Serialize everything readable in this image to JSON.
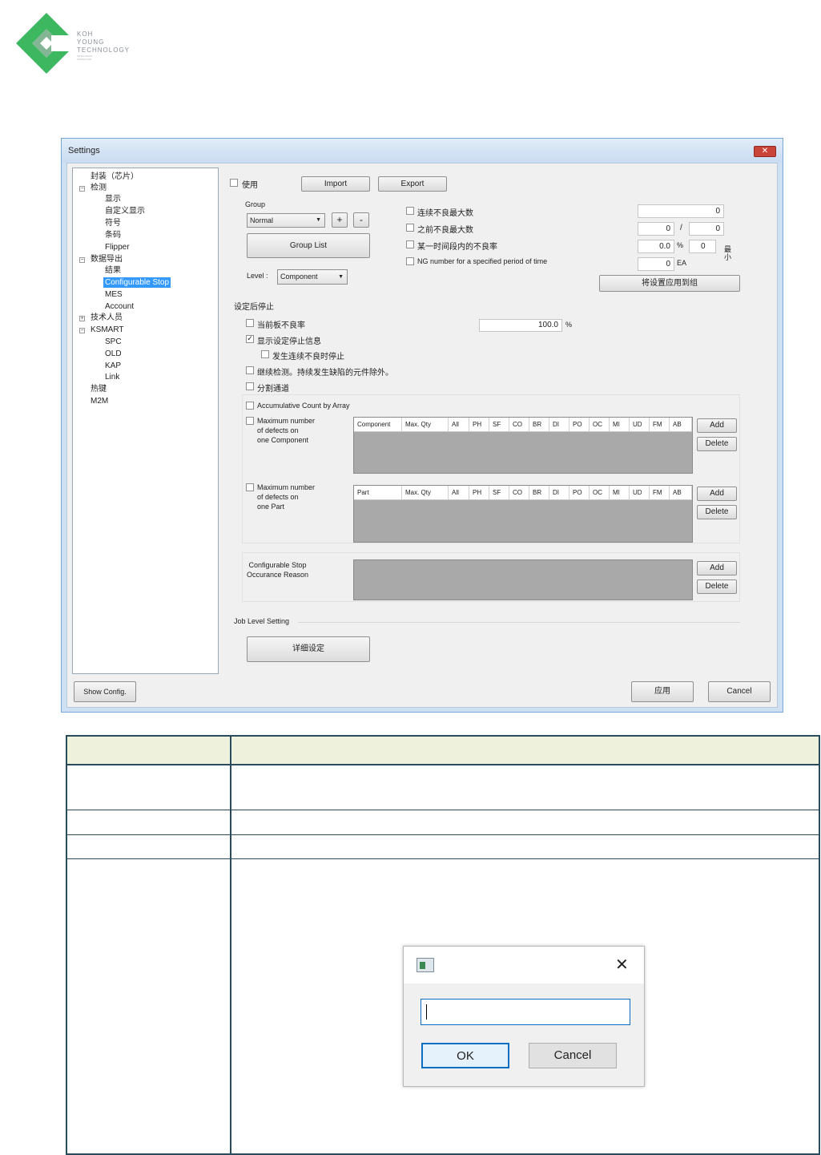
{
  "logo": {
    "line1": "KOH",
    "line2": "YOUNG",
    "line3": "TECHNOLOGY",
    "line4": "INTELLIGENT",
    "line5": "INSPECTION"
  },
  "window": {
    "title": "Settings",
    "close": "✕"
  },
  "tree": {
    "items": [
      "封装（芯片）",
      "检测",
      "显示",
      "自定义显示",
      "符号",
      "条码",
      "Flipper",
      "数据导出",
      "结果",
      "Configurable Stop",
      "MES",
      "Account",
      "技术人员",
      "KSMART",
      "SPC",
      "OLD",
      "KAP",
      "Link",
      "热键",
      "M2M"
    ]
  },
  "top": {
    "use_label": "使用",
    "import": "Import",
    "export": "Export"
  },
  "group": {
    "label": "Group",
    "selected": "Normal",
    "plus": "+",
    "minus": "-",
    "group_list": "Group List",
    "level_label": "Level :",
    "level_selected": "Component"
  },
  "rules": {
    "r1": "连续不良最大数",
    "r2": "之前不良最大数",
    "r3": "某一时间段内的不良率",
    "r4": "NG number for a specified period of time",
    "v1": "0",
    "v2a": "0",
    "v2sep": "/",
    "v2b": "0",
    "v3a": "0.0",
    "v3unit": "%",
    "v3b": "0",
    "v4": "0",
    "v4unit": "EA",
    "side_label": "最小",
    "apply_all": "将设置应用到组"
  },
  "stop": {
    "title": "设定后停止",
    "c1": "当前板不良率",
    "c1_value": "100.0",
    "c1_unit": "%",
    "c2": "显示设定停止信息",
    "c3": "发生连续不良时停止",
    "c4": "继续检测。持续发生缺陷的元件除外。",
    "c5": "分割通道"
  },
  "array": {
    "accumulative": "Accumulative Count by Array",
    "comp_label_1": "Maximum number",
    "comp_label_2": "of  defects  on",
    "comp_label_3": "one Component",
    "part_label_1": "Maximum number",
    "part_label_2": "of  defects  on",
    "part_label_3": "one Part",
    "comp_cols": [
      "Component",
      "Max. Qty",
      "All",
      "PH",
      "SF",
      "CO",
      "BR",
      "DI",
      "PO",
      "OC",
      "MI",
      "UD",
      "FM",
      "AB"
    ],
    "part_cols": [
      "Part",
      "Max. Qty",
      "All",
      "PH",
      "SF",
      "CO",
      "BR",
      "DI",
      "PO",
      "OC",
      "MI",
      "UD",
      "FM",
      "AB"
    ],
    "add": "Add",
    "delete": "Delete",
    "reason_1": "Configurable Stop",
    "reason_2": "Occurance Reason"
  },
  "job": {
    "title": "Job Level Setting",
    "detail": "详细设定"
  },
  "footer": {
    "show_config": "Show Config.",
    "apply": "应用",
    "cancel": "Cancel"
  },
  "dialog": {
    "ok": "OK",
    "cancel": "Cancel",
    "close": "✕"
  },
  "colors": {
    "logo_green": "#3db860",
    "logo_dark": "#1e7a3c",
    "table_border": "#2a4b5c",
    "table_header": "#eef2dc",
    "selection": "#3399ff"
  }
}
